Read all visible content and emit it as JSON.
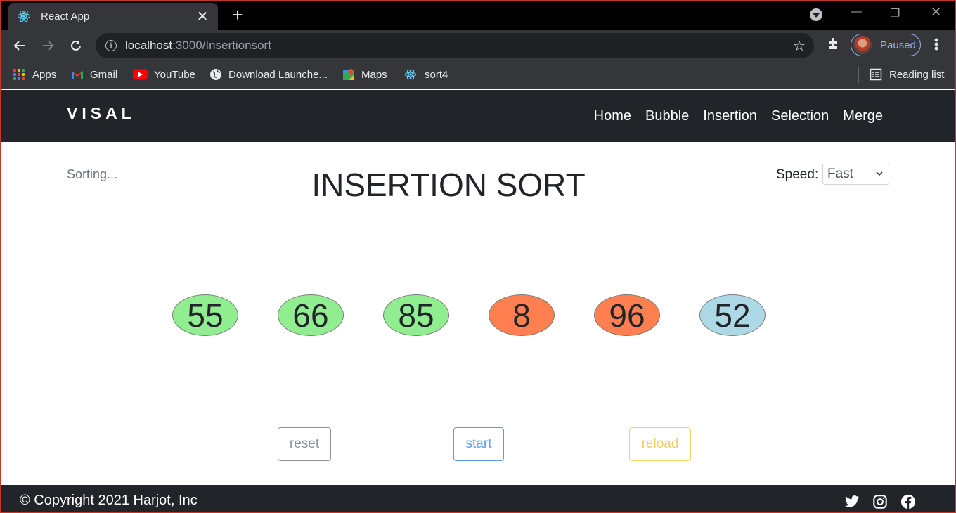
{
  "browser": {
    "tab_title": "React App",
    "url_host": "localhost",
    "url_path": ":3000/Insertionsort",
    "profile_status": "Paused",
    "bookmarks": [
      {
        "label": "Apps",
        "icon": "apps-grid-icon"
      },
      {
        "label": "Gmail",
        "icon": "gmail-icon"
      },
      {
        "label": "YouTube",
        "icon": "youtube-icon"
      },
      {
        "label": "Download Launche...",
        "icon": "globe-icon"
      },
      {
        "label": "Maps",
        "icon": "maps-icon"
      },
      {
        "label": "sort4",
        "icon": "react-icon"
      }
    ],
    "reading_list": "Reading list"
  },
  "app": {
    "brand": "VISAL",
    "nav": [
      "Home",
      "Bubble",
      "Insertion",
      "Selection",
      "Merge"
    ],
    "status": "Sorting...",
    "title": "INSERTION SORT",
    "speed_label": "Speed:",
    "speed_value": "Fast",
    "array": [
      {
        "value": "55",
        "state": "sorted",
        "color": "#90ee90"
      },
      {
        "value": "66",
        "state": "sorted",
        "color": "#90ee90"
      },
      {
        "value": "85",
        "state": "sorted",
        "color": "#90ee90"
      },
      {
        "value": "8",
        "state": "comparing",
        "color": "#ff7f50"
      },
      {
        "value": "96",
        "state": "comparing",
        "color": "#ff7f50"
      },
      {
        "value": "52",
        "state": "unsorted",
        "color": "#add8e6"
      }
    ],
    "buttons": {
      "reset": {
        "label": "reset",
        "color": "#6c757d"
      },
      "start": {
        "label": "start",
        "color": "#0d6efd"
      },
      "reload": {
        "label": "reload",
        "color": "#ffc107"
      }
    },
    "footer": {
      "copyright": "© Copyright 2021 Harjot, Inc",
      "social": [
        "twitter-icon",
        "instagram-icon",
        "facebook-icon"
      ]
    }
  }
}
